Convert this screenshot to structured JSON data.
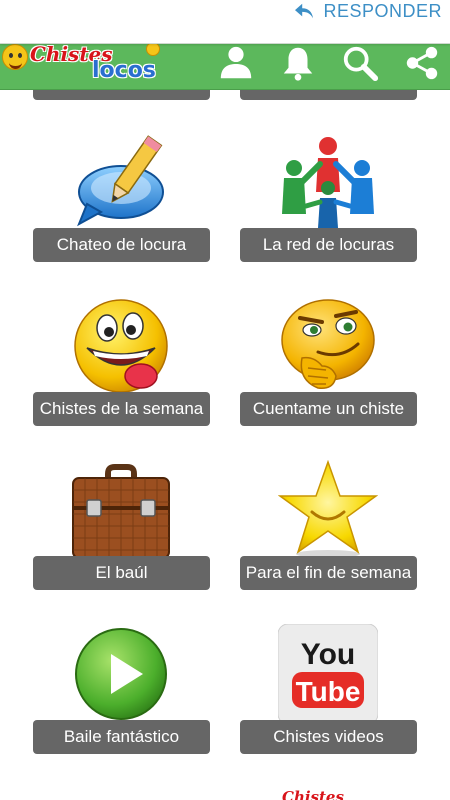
{
  "reply": {
    "label": "RESPONDER"
  },
  "header": {
    "logo_line1": "Chistes",
    "logo_line2": "locos",
    "icons": [
      "user-icon",
      "bell-icon",
      "search-icon",
      "share-icon"
    ]
  },
  "colors": {
    "header_green": "#5cb85c",
    "label_gray": "#666666",
    "reply_blue": "#3d8fc6"
  },
  "tiles": [
    {
      "label": "Chateo de locura",
      "icon": "chat-pencil-icon"
    },
    {
      "label": "La red de locuras",
      "icon": "people-network-icon"
    },
    {
      "label": "Chistes de la semana",
      "icon": "laughing-emoji-icon"
    },
    {
      "label": "Cuentame un chiste",
      "icon": "smirking-emoji-icon"
    },
    {
      "label": "El baúl",
      "icon": "briefcase-icon"
    },
    {
      "label": "Para el fin de semana",
      "icon": "star-icon"
    },
    {
      "label": "Baile fantástico",
      "icon": "play-icon"
    },
    {
      "label": "Chistes videos",
      "icon": "youtube-icon"
    }
  ],
  "footer": {
    "logo_text": "Chistes"
  }
}
